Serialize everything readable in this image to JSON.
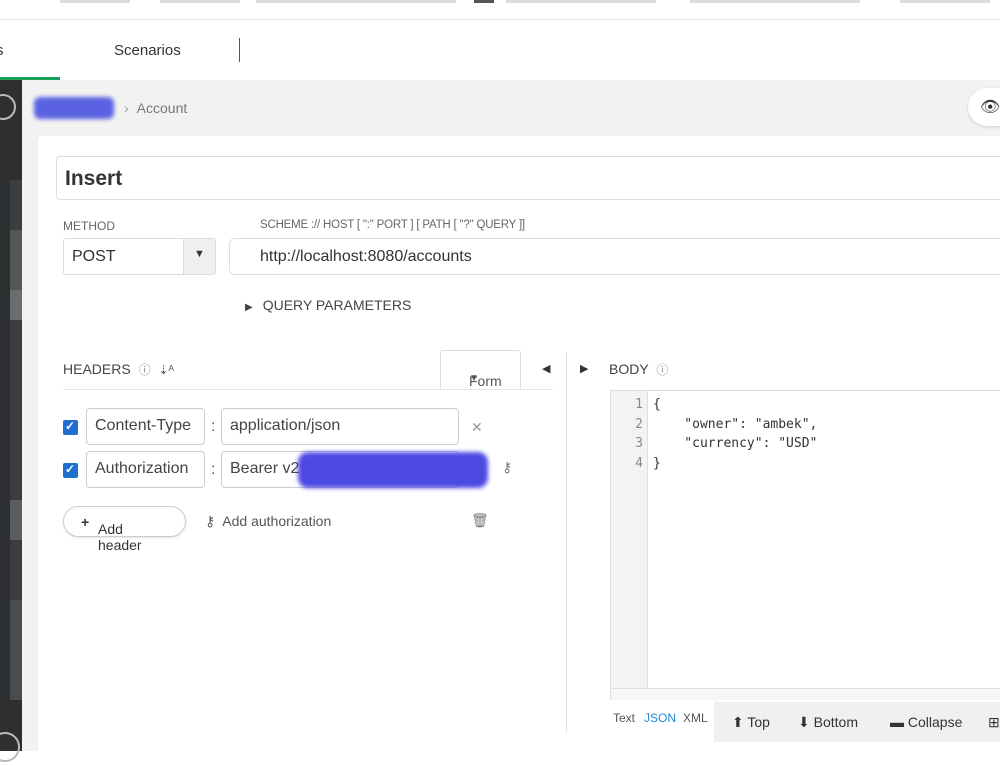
{
  "tabs": {
    "first_label": "s",
    "scenarios_label": "Scenarios"
  },
  "breadcrumb": {
    "current": "Account"
  },
  "request": {
    "name": "Insert",
    "method_label": "METHOD",
    "method_value": "POST",
    "url_label": "SCHEME :// HOST [ \":\" PORT ] [ PATH [ \"?\" QUERY ]]",
    "url_value": "http://localhost:8080/accounts",
    "query_params_label": "QUERY PARAMETERS"
  },
  "headers": {
    "title": "HEADERS",
    "form_label": "Form",
    "rows": [
      {
        "key": "Content-Type",
        "value": "application/json"
      },
      {
        "key": "Authorization",
        "value": "Bearer v2"
      }
    ],
    "add_header_label": "Add header",
    "add_auth_label": "Add authorization"
  },
  "body": {
    "title": "BODY",
    "line_numbers": [
      "1",
      "2",
      "3",
      "4"
    ],
    "lines": [
      "{",
      "    \"owner\": \"ambek\",",
      "    \"currency\": \"USD\"",
      "}"
    ],
    "formats": [
      "Text",
      "JSON",
      "XML"
    ],
    "active_format": "JSON",
    "toolbar": {
      "top": "Top",
      "bottom": "Bottom",
      "collapse": "Collapse"
    }
  },
  "icons": {
    "eye": "eye-icon",
    "help": "help-icon",
    "sort": "sort-icon",
    "caret": "caret-down-icon",
    "check": "checkbox-checked-icon",
    "close": "close-icon",
    "key": "key-icon",
    "plus": "plus-icon",
    "trash": "trash-icon"
  },
  "colors": {
    "accent": "#18a05a",
    "checkbox": "#1f6fd1",
    "json_string": "#a31515",
    "active_format": "#1f8ad6"
  }
}
